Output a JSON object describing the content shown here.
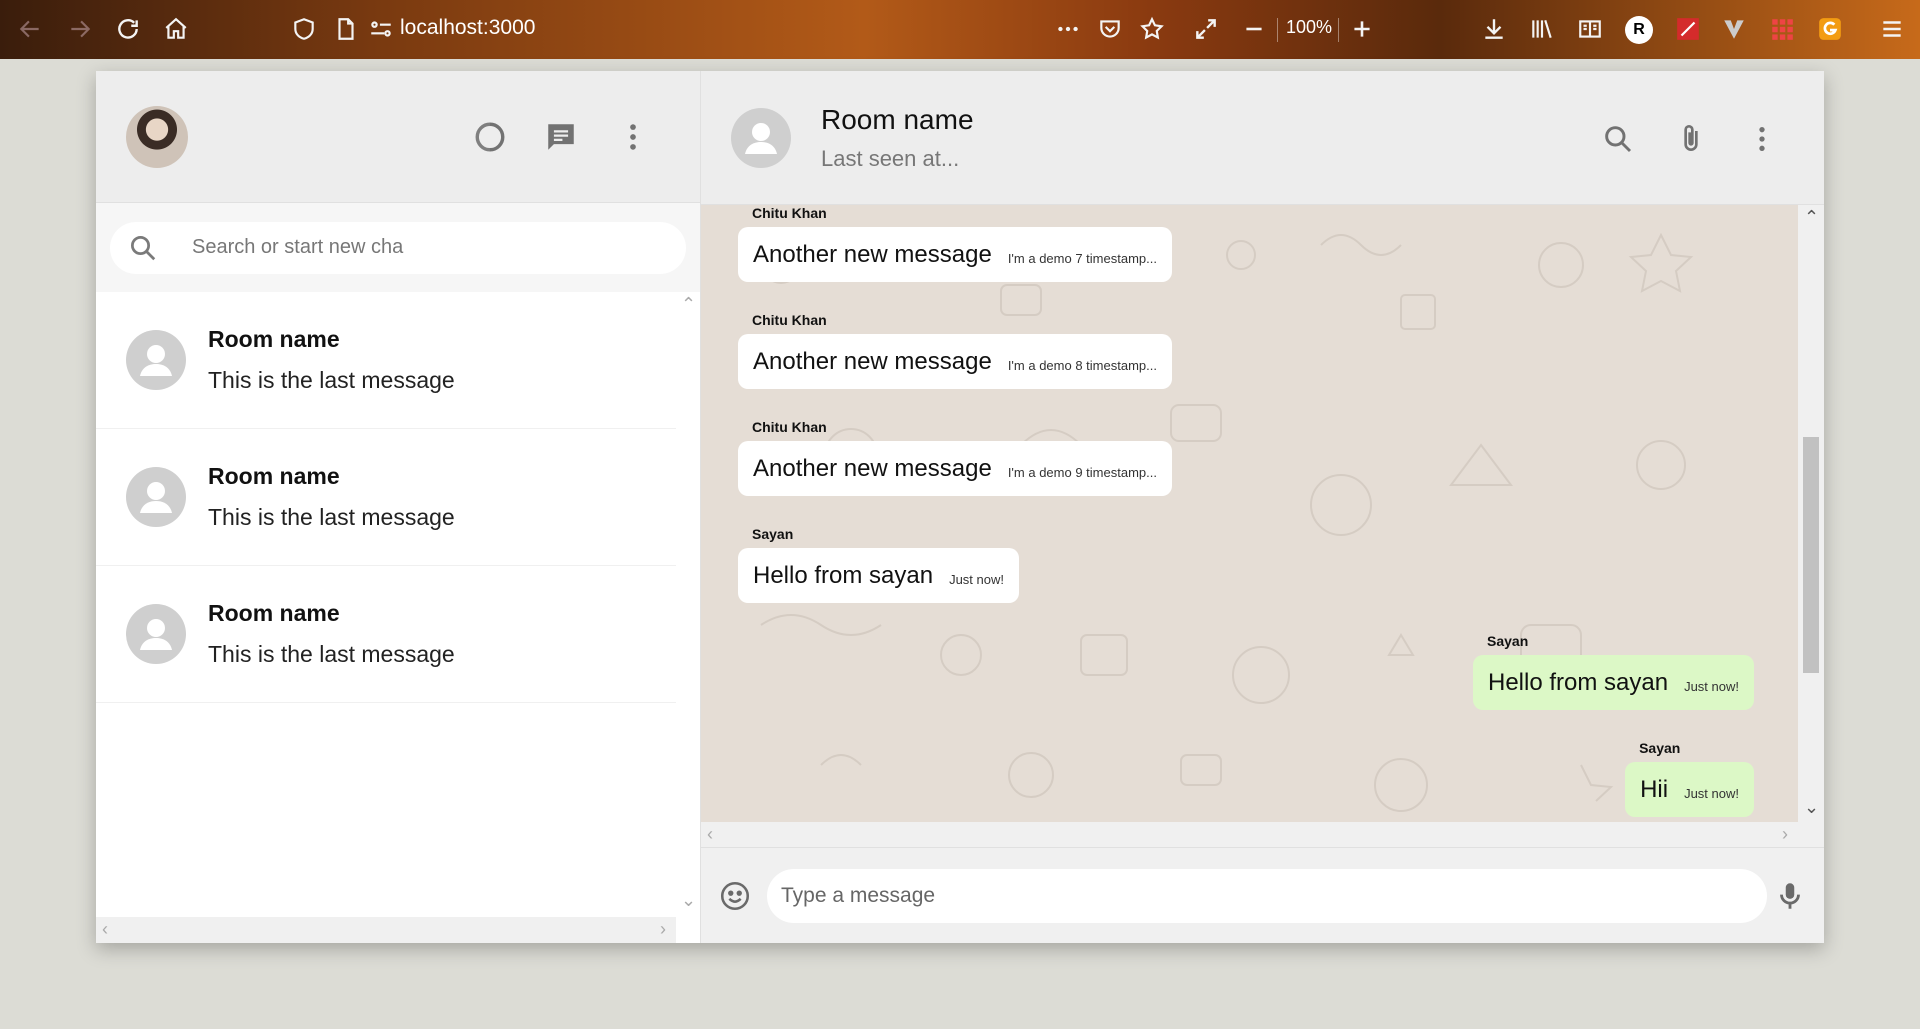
{
  "browser": {
    "url": "localhost:3000",
    "zoom": "100%",
    "profile_initial": "R"
  },
  "sidebar": {
    "search_placeholder": "Search or start new cha",
    "chats": [
      {
        "name": "Room name",
        "last_message": "This is the last message"
      },
      {
        "name": "Room name",
        "last_message": "This is the last message"
      },
      {
        "name": "Room name",
        "last_message": "This is the last message"
      }
    ]
  },
  "chat": {
    "title": "Room name",
    "subtitle": "Last seen at...",
    "messages": [
      {
        "sender": "Chitu Khan",
        "text": "Another new message",
        "time": "I'm a demo 7 timestamp...",
        "mine": false
      },
      {
        "sender": "Chitu Khan",
        "text": "Another new message",
        "time": "I'm a demo 8 timestamp...",
        "mine": false
      },
      {
        "sender": "Chitu Khan",
        "text": "Another new message",
        "time": "I'm a demo 9 timestamp...",
        "mine": false
      },
      {
        "sender": "Sayan",
        "text": "Hello from sayan",
        "time": "Just now!",
        "mine": false
      },
      {
        "sender": "Sayan",
        "text": "Hello from sayan",
        "time": "Just now!",
        "mine": true
      },
      {
        "sender": "Sayan",
        "text": "Hii",
        "time": "Just now!",
        "mine": true
      }
    ],
    "input_placeholder": "Type a message"
  }
}
